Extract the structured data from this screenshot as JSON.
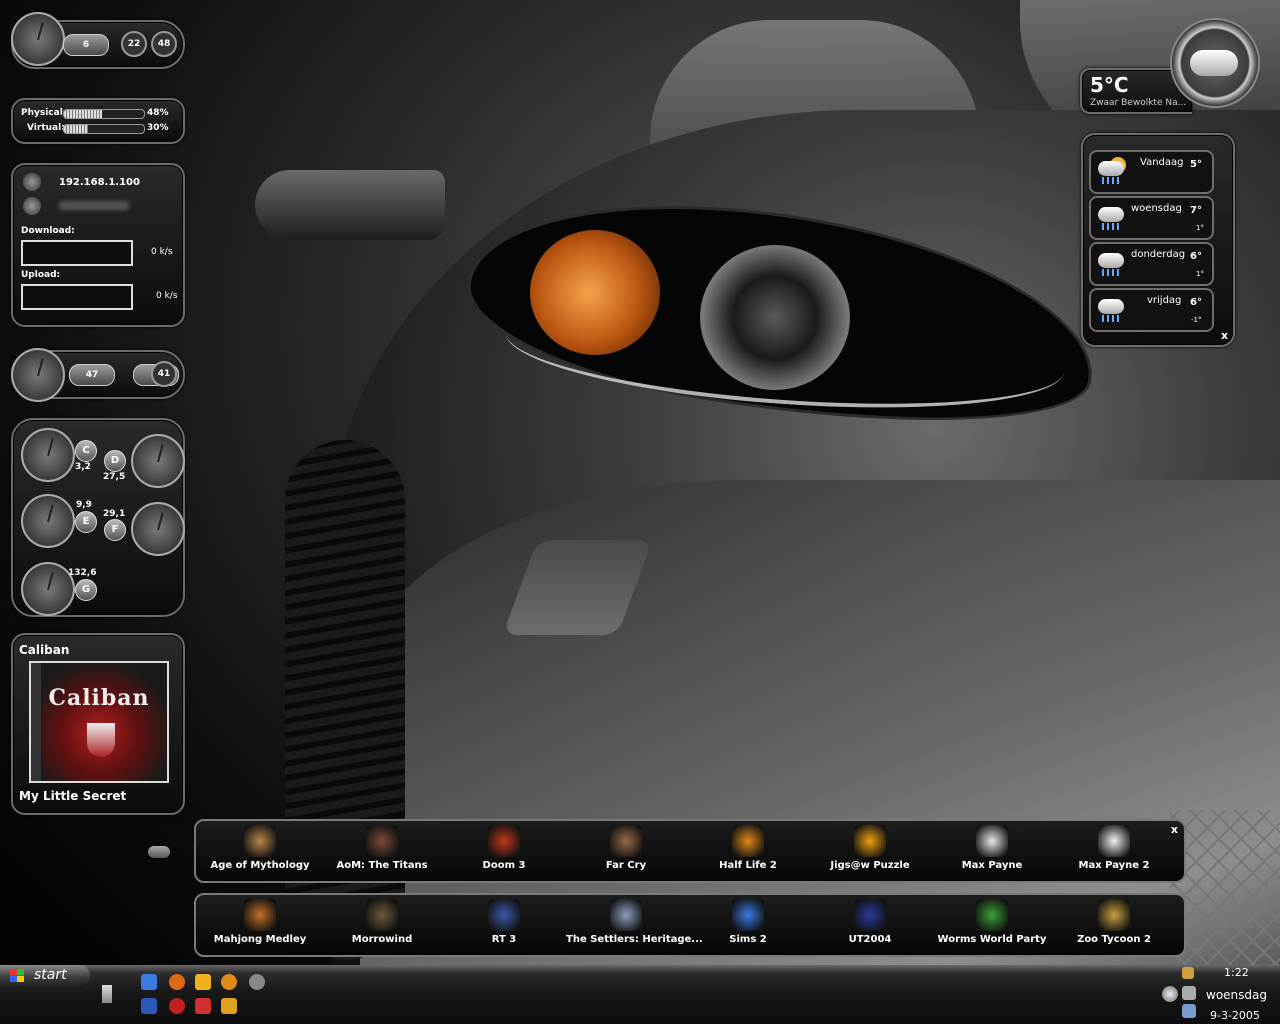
{
  "system_meter": {
    "v1": "6",
    "v2": "22",
    "v3": "48"
  },
  "memory": {
    "physical_label": "Physical:",
    "physical_value": "48%",
    "physical_pct": 0.48,
    "virtual_label": "Virtual:",
    "virtual_value": "30%",
    "virtual_pct": 0.3
  },
  "network": {
    "ip": "192.168.1.100",
    "download_label": "Download:",
    "download_value": "0 k/s",
    "upload_label": "Upload:",
    "upload_value": "0 k/s"
  },
  "temps": {
    "left": "47",
    "right": "41"
  },
  "drives": [
    {
      "letter": "C",
      "value": "3,2"
    },
    {
      "letter": "D",
      "value": "27,5"
    },
    {
      "letter": "E",
      "value": "9,9"
    },
    {
      "letter": "F",
      "value": "29,1"
    },
    {
      "letter": "G",
      "value": "132,6"
    }
  ],
  "music": {
    "artist": "Caliban",
    "album_art_text": "Caliban",
    "track": "My Little Secret"
  },
  "weather": {
    "current_temp": "5°C",
    "current_desc": "Zwaar Bewolkte Na...",
    "close": "x",
    "days": [
      {
        "day": "Vandaag",
        "high": "5°",
        "low": "",
        "icon": "sun-cloud-rain-icon"
      },
      {
        "day": "woensdag",
        "high": "7°",
        "low": "1°",
        "icon": "cloud-rain-icon"
      },
      {
        "day": "donderdag",
        "high": "6°",
        "low": "1°",
        "icon": "cloud-rain-icon"
      },
      {
        "day": "vrijdag",
        "high": "6°",
        "low": "-1°",
        "icon": "cloud-rain-icon"
      }
    ]
  },
  "dock1": {
    "close": "x",
    "items": [
      {
        "label": "Age of Mythology",
        "color": "#b8864a"
      },
      {
        "label": "AoM: The Titans",
        "color": "#7a4a3a"
      },
      {
        "label": "Doom 3",
        "color": "#c0391d"
      },
      {
        "label": "Far Cry",
        "color": "#9a6a4a"
      },
      {
        "label": "Half Life 2",
        "color": "#e08a18"
      },
      {
        "label": "Jigs@w Puzzle",
        "color": "#f0a010"
      },
      {
        "label": "Max Payne",
        "color": "#e8e8e8"
      },
      {
        "label": "Max Payne 2",
        "color": "#f0f0f0"
      }
    ]
  },
  "dock2": {
    "items": [
      {
        "label": "Mahjong Medley",
        "color": "#c0702a"
      },
      {
        "label": "Morrowind",
        "color": "#6d5a3a"
      },
      {
        "label": "RT 3",
        "color": "#3a5aa8"
      },
      {
        "label": "The Settlers: Heritage...",
        "color": "#8aa0c0"
      },
      {
        "label": "Sims 2",
        "color": "#3a7adf"
      },
      {
        "label": "UT2004",
        "color": "#2a3a9a"
      },
      {
        "label": "Worms World Party",
        "color": "#3aa03a"
      },
      {
        "label": "Zoo Tycoon 2",
        "color": "#c8a040"
      }
    ]
  },
  "taskbar": {
    "start_label": "start",
    "time": "1:22",
    "day": "woensdag",
    "date": "9-3-2005"
  }
}
